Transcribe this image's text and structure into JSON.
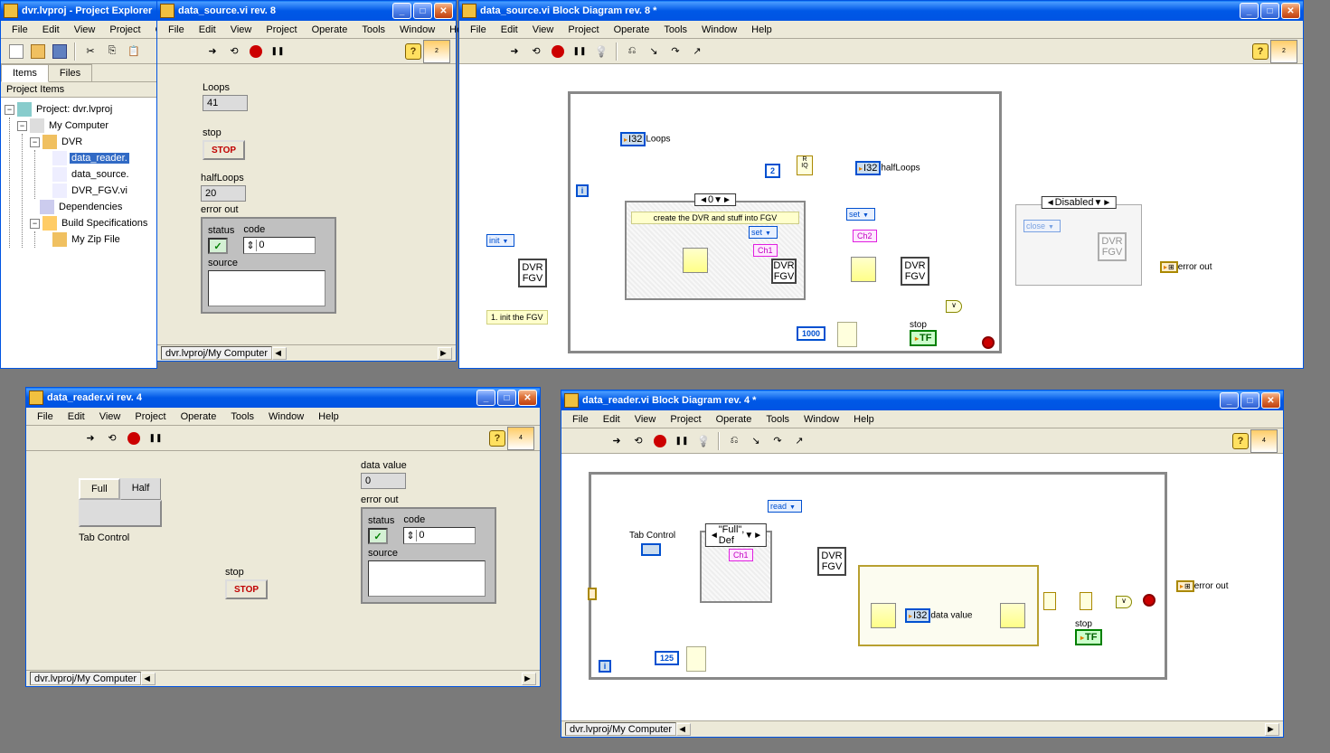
{
  "projectExplorer": {
    "title": "dvr.lvproj - Project Explorer",
    "menus": [
      "File",
      "Edit",
      "View",
      "Project",
      "Operate"
    ],
    "tabs": [
      "Items",
      "Files"
    ],
    "header": "Project Items",
    "root": "Project: dvr.lvproj",
    "nodes": {
      "myComputer": "My Computer",
      "dvr": "DVR",
      "dataReader": "data_reader.",
      "dataSource": "data_source.",
      "dvrFgv": "DVR_FGV.vi",
      "dependencies": "Dependencies",
      "buildSpecs": "Build Specifications",
      "zipFile": "My Zip File"
    }
  },
  "dataSourceFP": {
    "title": "data_source.vi rev. 8",
    "menus": [
      "File",
      "Edit",
      "View",
      "Project",
      "Operate",
      "Tools",
      "Window",
      "Help"
    ],
    "loops": {
      "label": "Loops",
      "value": "41"
    },
    "stop": {
      "label": "stop",
      "button": "STOP"
    },
    "halfLoops": {
      "label": "halfLoops",
      "value": "20"
    },
    "errorOut": {
      "label": "error out",
      "status": "status",
      "code": "code",
      "codeVal": "0",
      "source": "source"
    },
    "status": "dvr.lvproj/My Computer"
  },
  "dataSourceBD": {
    "title": "data_source.vi Block Diagram rev. 8 *",
    "menus": [
      "File",
      "Edit",
      "View",
      "Project",
      "Operate",
      "Tools",
      "Window",
      "Help"
    ],
    "initFgv": "1. init the FGV",
    "init": "init",
    "loops": "Loops",
    "halfLoops": "halfLoops",
    "caseHdr": "0",
    "caseComment": "create the DVR and stuff into FGV",
    "set": "set",
    "ch1": "Ch1",
    "ch2": "Ch2",
    "const1000": "1000",
    "const2": "2",
    "stop": "stop",
    "errorOut": "error out",
    "disabled": "Disabled",
    "close": "close",
    "dvrFgv": "DVR FGV",
    "i32": "I32",
    "tf": "TF"
  },
  "dataReaderFP": {
    "title": "data_reader.vi rev. 4",
    "menus": [
      "File",
      "Edit",
      "View",
      "Project",
      "Operate",
      "Tools",
      "Window",
      "Help"
    ],
    "tabControl": "Tab Control",
    "tabs": [
      "Full",
      "Half"
    ],
    "dataValue": {
      "label": "data value",
      "value": "0"
    },
    "errorOut": {
      "label": "error out",
      "status": "status",
      "code": "code",
      "codeVal": "0",
      "source": "source"
    },
    "stop": {
      "label": "stop",
      "button": "STOP"
    },
    "status": "dvr.lvproj/My Computer"
  },
  "dataReaderBD": {
    "title": "data_reader.vi Block Diagram rev. 4 *",
    "menus": [
      "File",
      "Edit",
      "View",
      "Project",
      "Operate",
      "Tools",
      "Window",
      "Help"
    ],
    "read": "read",
    "tabControl": "Tab Control",
    "caseHdr": "\"Full\", Def",
    "ch1": "Ch1",
    "dataValue": "data value",
    "const125": "125",
    "stop": "stop",
    "errorOut": "error out",
    "dvrFgv": "DVR FGV",
    "i32": "I32",
    "tf": "TF",
    "status": "dvr.lvproj/My Computer"
  }
}
